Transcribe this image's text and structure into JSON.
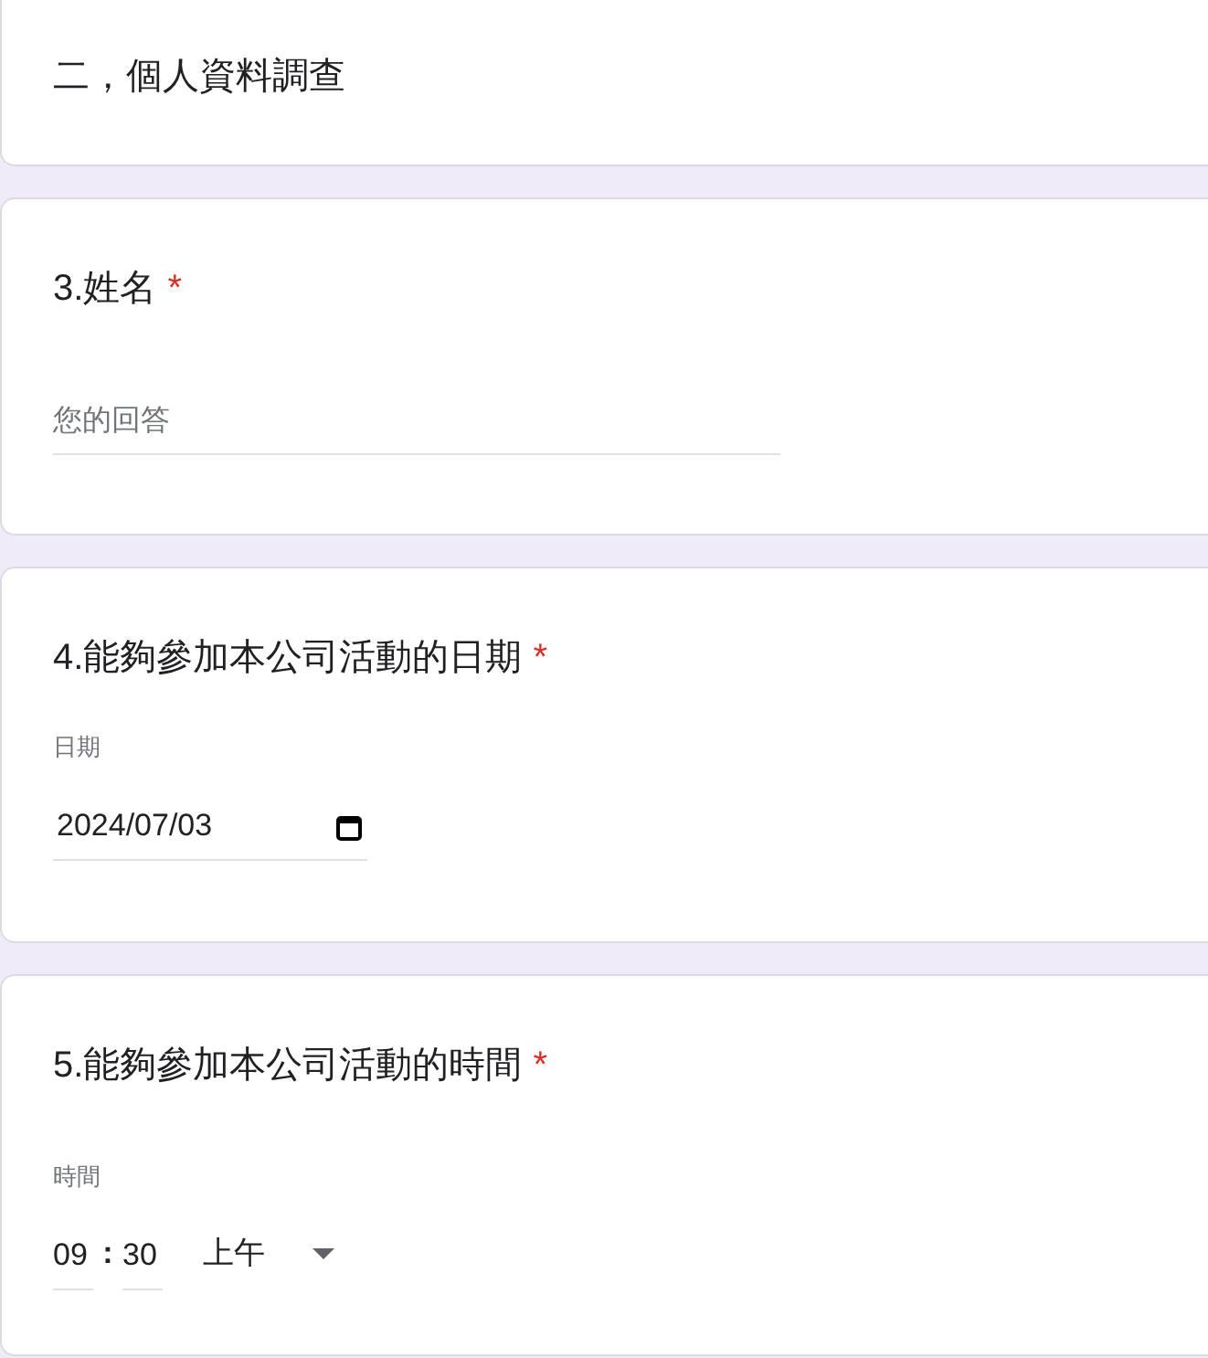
{
  "section": {
    "title": "二，個人資料調查"
  },
  "questions": [
    {
      "kind": "text",
      "title": "3.姓名",
      "required_mark": "*",
      "placeholder": "您的回答"
    },
    {
      "kind": "date",
      "title": "4.能夠參加本公司活動的日期",
      "required_mark": "*",
      "field_label": "日期",
      "value": "2024/07/03"
    },
    {
      "kind": "time",
      "title": "5.能夠參加本公司活動的時間",
      "required_mark": "*",
      "field_label": "時間",
      "hour": "09",
      "separator": ":",
      "minute": "30",
      "period": "上午"
    }
  ]
}
